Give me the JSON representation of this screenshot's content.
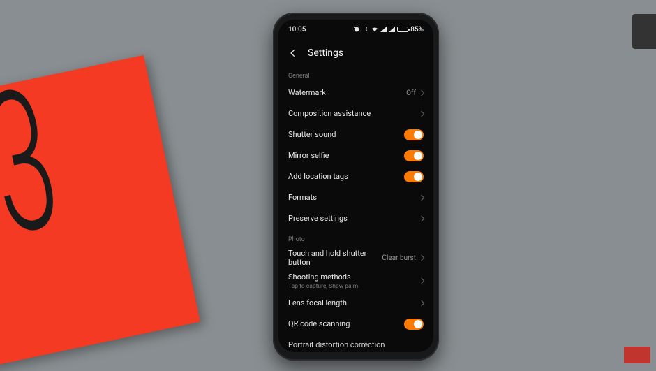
{
  "statusbar": {
    "time": "10:05",
    "battery_pct": "85%"
  },
  "header": {
    "title": "Settings"
  },
  "sections": {
    "general": {
      "label": "General",
      "watermark": {
        "label": "Watermark",
        "value": "Off"
      },
      "composition": {
        "label": "Composition assistance"
      },
      "shutter_sound": {
        "label": "Shutter sound"
      },
      "mirror_selfie": {
        "label": "Mirror selfie"
      },
      "location_tags": {
        "label": "Add location tags"
      },
      "formats": {
        "label": "Formats"
      },
      "preserve": {
        "label": "Preserve settings"
      }
    },
    "photo": {
      "label": "Photo",
      "touch_hold": {
        "label": "Touch and hold shutter button",
        "value": "Clear burst"
      },
      "shooting": {
        "label": "Shooting methods",
        "sub": "Tap to capture, Show palm"
      },
      "lens_focal": {
        "label": "Lens focal length"
      },
      "qr": {
        "label": "QR code scanning"
      },
      "portrait": {
        "label": "Portrait distortion correction"
      }
    }
  },
  "colors": {
    "accent": "#ff7a00"
  }
}
